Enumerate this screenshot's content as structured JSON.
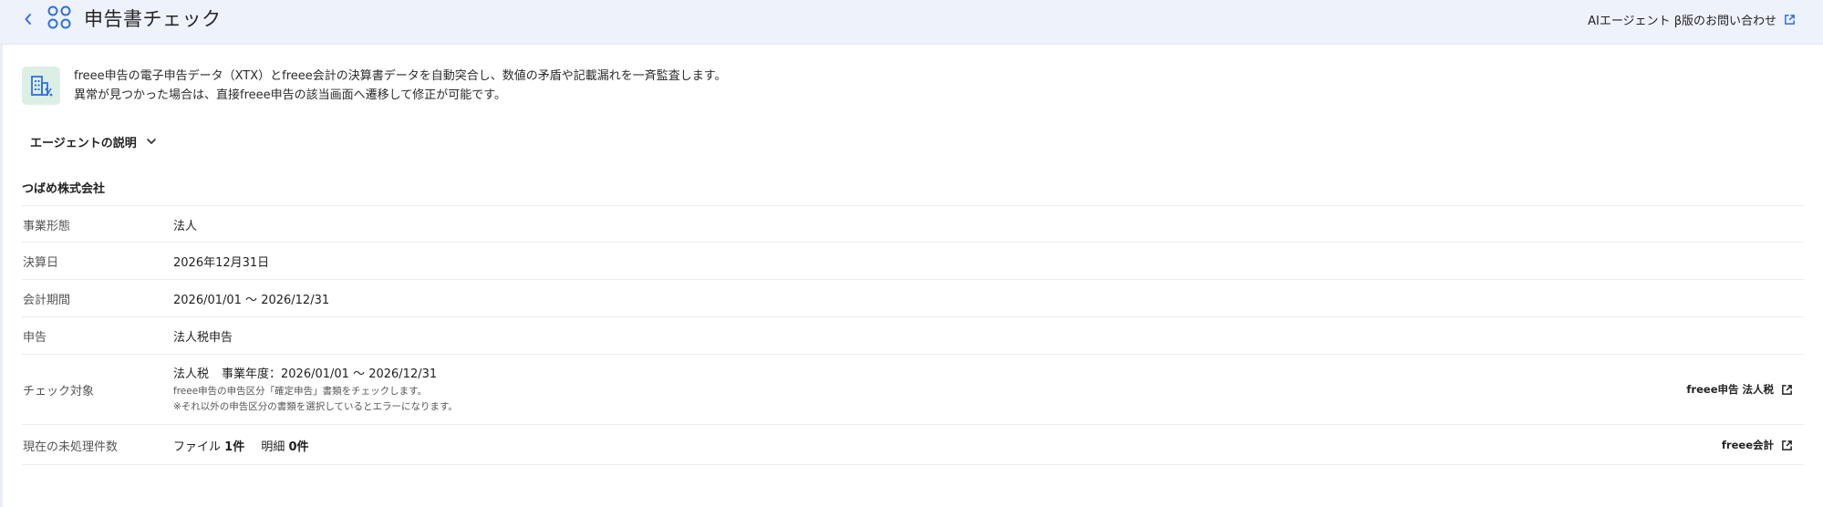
{
  "header": {
    "title": "申告書チェック",
    "inquiry_label": "AIエージェント β版のお問い合わせ",
    "back_icon": "chevron-left-icon",
    "app_icon": "four-circles-icon",
    "external_icon": "external-link-icon"
  },
  "intro": {
    "line1": "freee申告の電子申告データ（XTX）とfreee会計の決算書データを自動突合し、数値の矛盾や記載漏れを一斉監査します。",
    "line2": "異常が見つかった場合は、直接freee申告の該当画面へ遷移して修正が可能です。",
    "icon": "building-percent-icon"
  },
  "agent_description": {
    "label": "エージェントの説明",
    "icon": "chevron-down-icon"
  },
  "company": {
    "name": "つばめ株式会社"
  },
  "details": {
    "business_type": {
      "label": "事業形態",
      "value": "法人"
    },
    "closing_date": {
      "label": "決算日",
      "value": "2026年12月31日"
    },
    "fiscal_period": {
      "label": "会計期間",
      "value": "2026/01/01 〜 2026/12/31"
    },
    "filing": {
      "label": "申告",
      "value": "法人税申告"
    },
    "check_target": {
      "label": "チェック対象",
      "tax": "法人税",
      "fiscal_year": "事業年度：2026/01/01 〜 2026/12/31",
      "note1": "freee申告の申告区分「確定申告」書類をチェックします。",
      "note2": "※それ以外の申告区分の書類を選択しているとエラーになります。",
      "link_label": "freee申告 法人税"
    },
    "pending": {
      "label": "現在の未処理件数",
      "files_label": "ファイル",
      "files_count": "1件",
      "items_label": "明細",
      "items_count": "0件",
      "link_label": "freee会計"
    }
  },
  "colors": {
    "header_bg": "#eef2fb",
    "accent_blue": "#2f6fe0",
    "intro_icon_bg": "#dcefe5",
    "divider": "#ececec"
  }
}
